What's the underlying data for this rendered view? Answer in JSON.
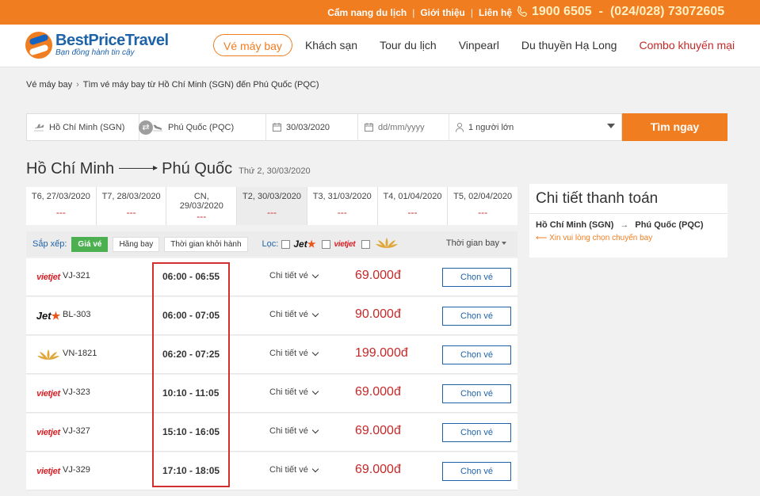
{
  "topbar": {
    "links": [
      "Cẩm nang du lịch",
      "Giới thiệu",
      "Liên hệ"
    ],
    "hotline_1": "1900 6505",
    "hotline_sep": "-",
    "hotline_2": "(024/028) 73072605"
  },
  "header": {
    "brand": "BestPriceTravel",
    "tagline": "Bạn đồng hành tin cậy",
    "nav": [
      "Vé máy bay",
      "Khách sạn",
      "Tour du lịch",
      "Vinpearl",
      "Du thuyền Hạ Long",
      "Combo khuyến mại"
    ]
  },
  "breadcrumb": [
    "Vé máy bay",
    "Tìm vé máy bay từ Hồ Chí Minh (SGN) đến Phú Quốc (PQC)"
  ],
  "search": {
    "from": "Hồ Chí Minh (SGN)",
    "to": "Phú Quốc (PQC)",
    "depart": "30/03/2020",
    "return_placeholder": "dd/mm/yyyy",
    "passengers": "1 người lớn",
    "button": "Tìm ngay"
  },
  "route": {
    "from": "Hồ Chí Minh",
    "to": "Phú Quốc",
    "date": "Thứ 2, 30/03/2020"
  },
  "date_tabs": [
    {
      "line1": "T6, 27/03/2020",
      "line2": "",
      "price": "---"
    },
    {
      "line1": "T7, 28/03/2020",
      "line2": "",
      "price": "---"
    },
    {
      "line1": "CN,",
      "line2": "29/03/2020",
      "price": "---"
    },
    {
      "line1": "T2, 30/03/2020",
      "line2": "",
      "price": "---"
    },
    {
      "line1": "T3, 31/03/2020",
      "line2": "",
      "price": "---"
    },
    {
      "line1": "T4, 01/04/2020",
      "line2": "",
      "price": "---"
    },
    {
      "line1": "T5, 02/04/2020",
      "line2": "",
      "price": "---"
    }
  ],
  "sort": {
    "label": "Sắp xếp:",
    "options": [
      "Giá vé",
      "Hãng bay",
      "Thời gian khởi hành"
    ],
    "filter_label": "Lọc:",
    "airline_jet": "Jet",
    "airline_vj": "vietjet",
    "right_label": "Thời gian bay"
  },
  "flights": [
    {
      "airline": "vietjet",
      "code": "VJ-321",
      "time": "06:00 - 06:55",
      "detail": "Chi tiết vé",
      "price": "69.000đ",
      "button": "Chọn vé"
    },
    {
      "airline": "jetstar",
      "code": "BL-303",
      "time": "06:00 - 07:05",
      "detail": "Chi tiết vé",
      "price": "90.000đ",
      "button": "Chọn vé"
    },
    {
      "airline": "vietnam-airlines",
      "code": "VN-1821",
      "time": "06:20 - 07:25",
      "detail": "Chi tiết vé",
      "price": "199.000đ",
      "button": "Chọn vé"
    },
    {
      "airline": "vietjet",
      "code": "VJ-323",
      "time": "10:10 - 11:05",
      "detail": "Chi tiết vé",
      "price": "69.000đ",
      "button": "Chọn vé"
    },
    {
      "airline": "vietjet",
      "code": "VJ-327",
      "time": "15:10 - 16:05",
      "detail": "Chi tiết vé",
      "price": "69.000đ",
      "button": "Chọn vé"
    },
    {
      "airline": "vietjet",
      "code": "VJ-329",
      "time": "17:10 - 18:05",
      "detail": "Chi tiết vé",
      "price": "69.000đ",
      "button": "Chọn vé"
    }
  ],
  "payment": {
    "title": "Chi tiết thanh toán",
    "from": "Hồ Chí Minh (SGN)",
    "to": "Phú Quốc (PQC)",
    "hint": "Xin vui lòng chọn chuyến bay"
  },
  "colors": {
    "brand_orange": "#f07d1f",
    "brand_blue": "#1e63a8",
    "price_red": "#c62828",
    "highlight_red": "#d32f2f",
    "sort_active": "#4caf50"
  }
}
